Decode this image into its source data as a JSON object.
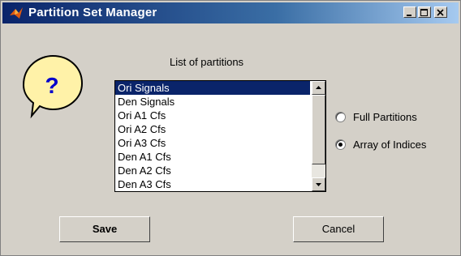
{
  "window": {
    "title": "Partition Set Manager"
  },
  "help_bubble": {
    "symbol": "?",
    "color": "#fff2a8"
  },
  "list": {
    "title": "List of partitions",
    "items": [
      "Ori Signals",
      "Den Signals",
      "Ori A1 Cfs",
      "Ori A2 Cfs",
      "Ori A3 Cfs",
      "Den A1 Cfs",
      "Den A2 Cfs",
      "Den A3 Cfs"
    ],
    "selected_index": 0
  },
  "options": {
    "full_partitions": {
      "label": "Full Partitions",
      "checked": false
    },
    "array_of_indices": {
      "label": "Array of Indices",
      "checked": true
    }
  },
  "buttons": {
    "save": "Save",
    "cancel": "Cancel"
  },
  "colors": {
    "titlebar_start": "#0a246a",
    "titlebar_end": "#a6caf0",
    "face": "#d4d0c8",
    "selection": "#0a246a"
  }
}
